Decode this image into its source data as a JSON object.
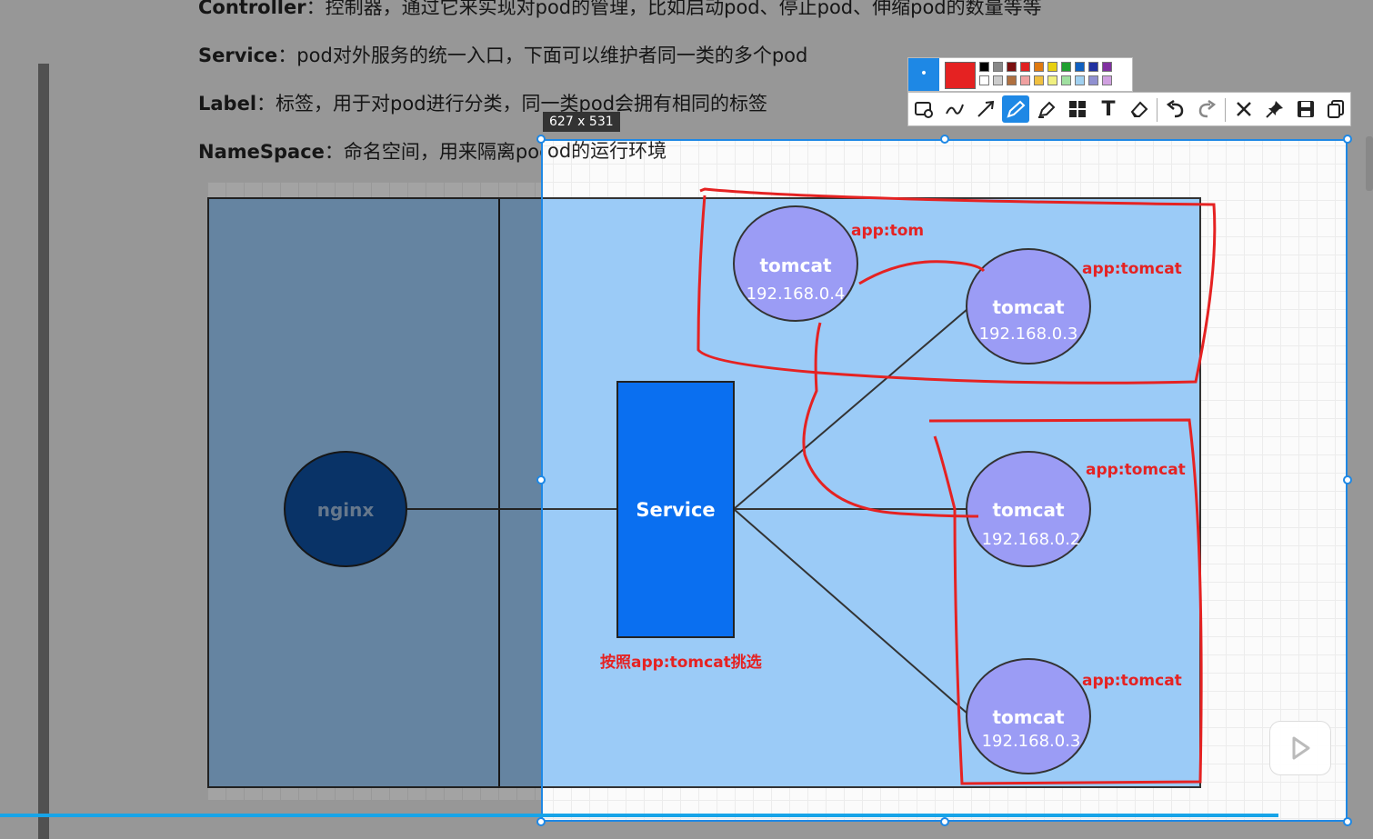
{
  "doc": {
    "lines": [
      {
        "term": "Controller",
        "desc": "：控制器，通过它来实现对pod的管理，比如启动pod、停止pod、伸缩pod的数量等等"
      },
      {
        "term": "Service",
        "desc": "：pod对外服务的统一入口，下面可以维护者同一类的多个pod"
      },
      {
        "term": "Label",
        "desc": "：标签，用于对pod进行分类，同一类pod会拥有相同的标签"
      },
      {
        "term": "NameSpace",
        "desc": "：命名空间，用来隔离pod的运行环境"
      }
    ]
  },
  "selection": {
    "size_label": "627 x 531"
  },
  "diagram": {
    "nginx_label": "nginx",
    "service_label": "Service",
    "pods": [
      {
        "name": "tomcat",
        "ip": "192.168.0.4",
        "tag": "app:tom"
      },
      {
        "name": "tomcat",
        "ip": "192.168.0.3",
        "tag": "app:tomcat"
      },
      {
        "name": "tomcat",
        "ip": "192.168.0.2",
        "tag": "app:tomcat"
      },
      {
        "name": "tomcat",
        "ip": "192.168.0.3",
        "tag": "app:tomcat"
      }
    ],
    "selector_note": "按照app:tomcat挑选"
  },
  "colors": {
    "accent": "#1e88e5",
    "annotation_red": "#e52222",
    "pod_fill": "#9b9cf5",
    "service_fill": "#0a6ff0",
    "nginx_fill": "#0f4f9e"
  },
  "toolbar": {
    "tools": [
      "rectangle-icon",
      "freehand-icon",
      "arrow-icon",
      "pen-icon",
      "marker-icon",
      "mosaic-icon",
      "text-icon",
      "eraser-icon",
      "undo-icon",
      "redo-icon",
      "close-icon",
      "pin-icon",
      "save-icon",
      "copy-icon"
    ],
    "text_tool_label": "T"
  }
}
